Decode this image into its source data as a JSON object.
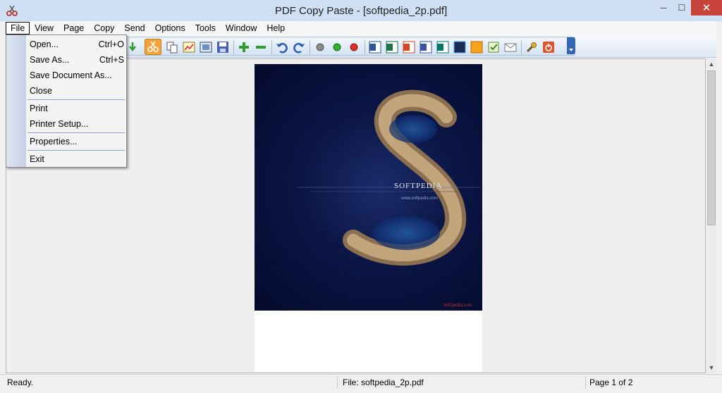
{
  "window": {
    "title": "PDF Copy Paste - [softpedia_2p.pdf]",
    "minimize": "─",
    "maximize": "☐",
    "close": "✕"
  },
  "menubar": {
    "items": [
      {
        "label": "File"
      },
      {
        "label": "View"
      },
      {
        "label": "Page"
      },
      {
        "label": "Copy"
      },
      {
        "label": "Send"
      },
      {
        "label": "Options"
      },
      {
        "label": "Tools"
      },
      {
        "label": "Window"
      },
      {
        "label": "Help"
      }
    ]
  },
  "file_menu": {
    "open": {
      "label": "Open...",
      "shortcut": "Ctrl+O"
    },
    "save_as": {
      "label": "Save As...",
      "shortcut": "Ctrl+S"
    },
    "save_document_as": {
      "label": "Save Document As..."
    },
    "close": {
      "label": "Close"
    },
    "print": {
      "label": "Print"
    },
    "printer_setup": {
      "label": "Printer Setup..."
    },
    "properties": {
      "label": "Properties..."
    },
    "exit": {
      "label": "Exit"
    }
  },
  "document": {
    "logo_text": "SOFTPEDIA",
    "url_text": "www.softpedia.com",
    "watermark_text": "Softpedia.com"
  },
  "statusbar": {
    "state": "Ready.",
    "file": "File: softpedia_2p.pdf",
    "page": "Page 1 of 2"
  },
  "colors": {
    "titlebar": "#cfe0f5",
    "close_button": "#c7433a",
    "page_background": "#040a2c"
  }
}
